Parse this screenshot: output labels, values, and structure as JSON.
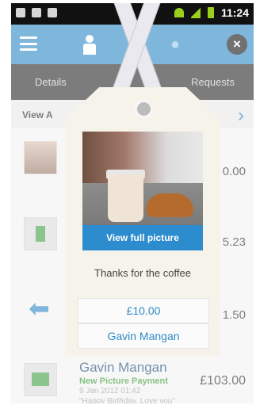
{
  "status_bar": {
    "time": "11:24"
  },
  "header": {
    "menu_icon": "menu-icon",
    "tabs": [
      {
        "icon": "person-icon",
        "active": true
      },
      {
        "icon": "brand-icon",
        "active": false
      },
      {
        "icon": "chat-icon",
        "active": false
      }
    ],
    "close_icon": "close-icon"
  },
  "subtabs": {
    "details": "Details",
    "requests": "Requests"
  },
  "list": {
    "view_all": "View A",
    "rows": [
      {
        "amount": "0.00"
      },
      {
        "amount": "5.23"
      },
      {
        "amount": "1.50"
      },
      {
        "name": "Gavin Mangan",
        "type": "New Picture Payment",
        "date": "9 Jan 2012 01:42",
        "note": "\"Happy Birthday, Love you\"",
        "amount": "£103.00"
      }
    ]
  },
  "tag": {
    "view_full": "View full picture",
    "message": "Thanks for the coffee",
    "amount": "£10.00",
    "name": "Gavin Mangan"
  },
  "colors": {
    "accent": "#2f89c7",
    "dark": "#2d2d2d"
  }
}
